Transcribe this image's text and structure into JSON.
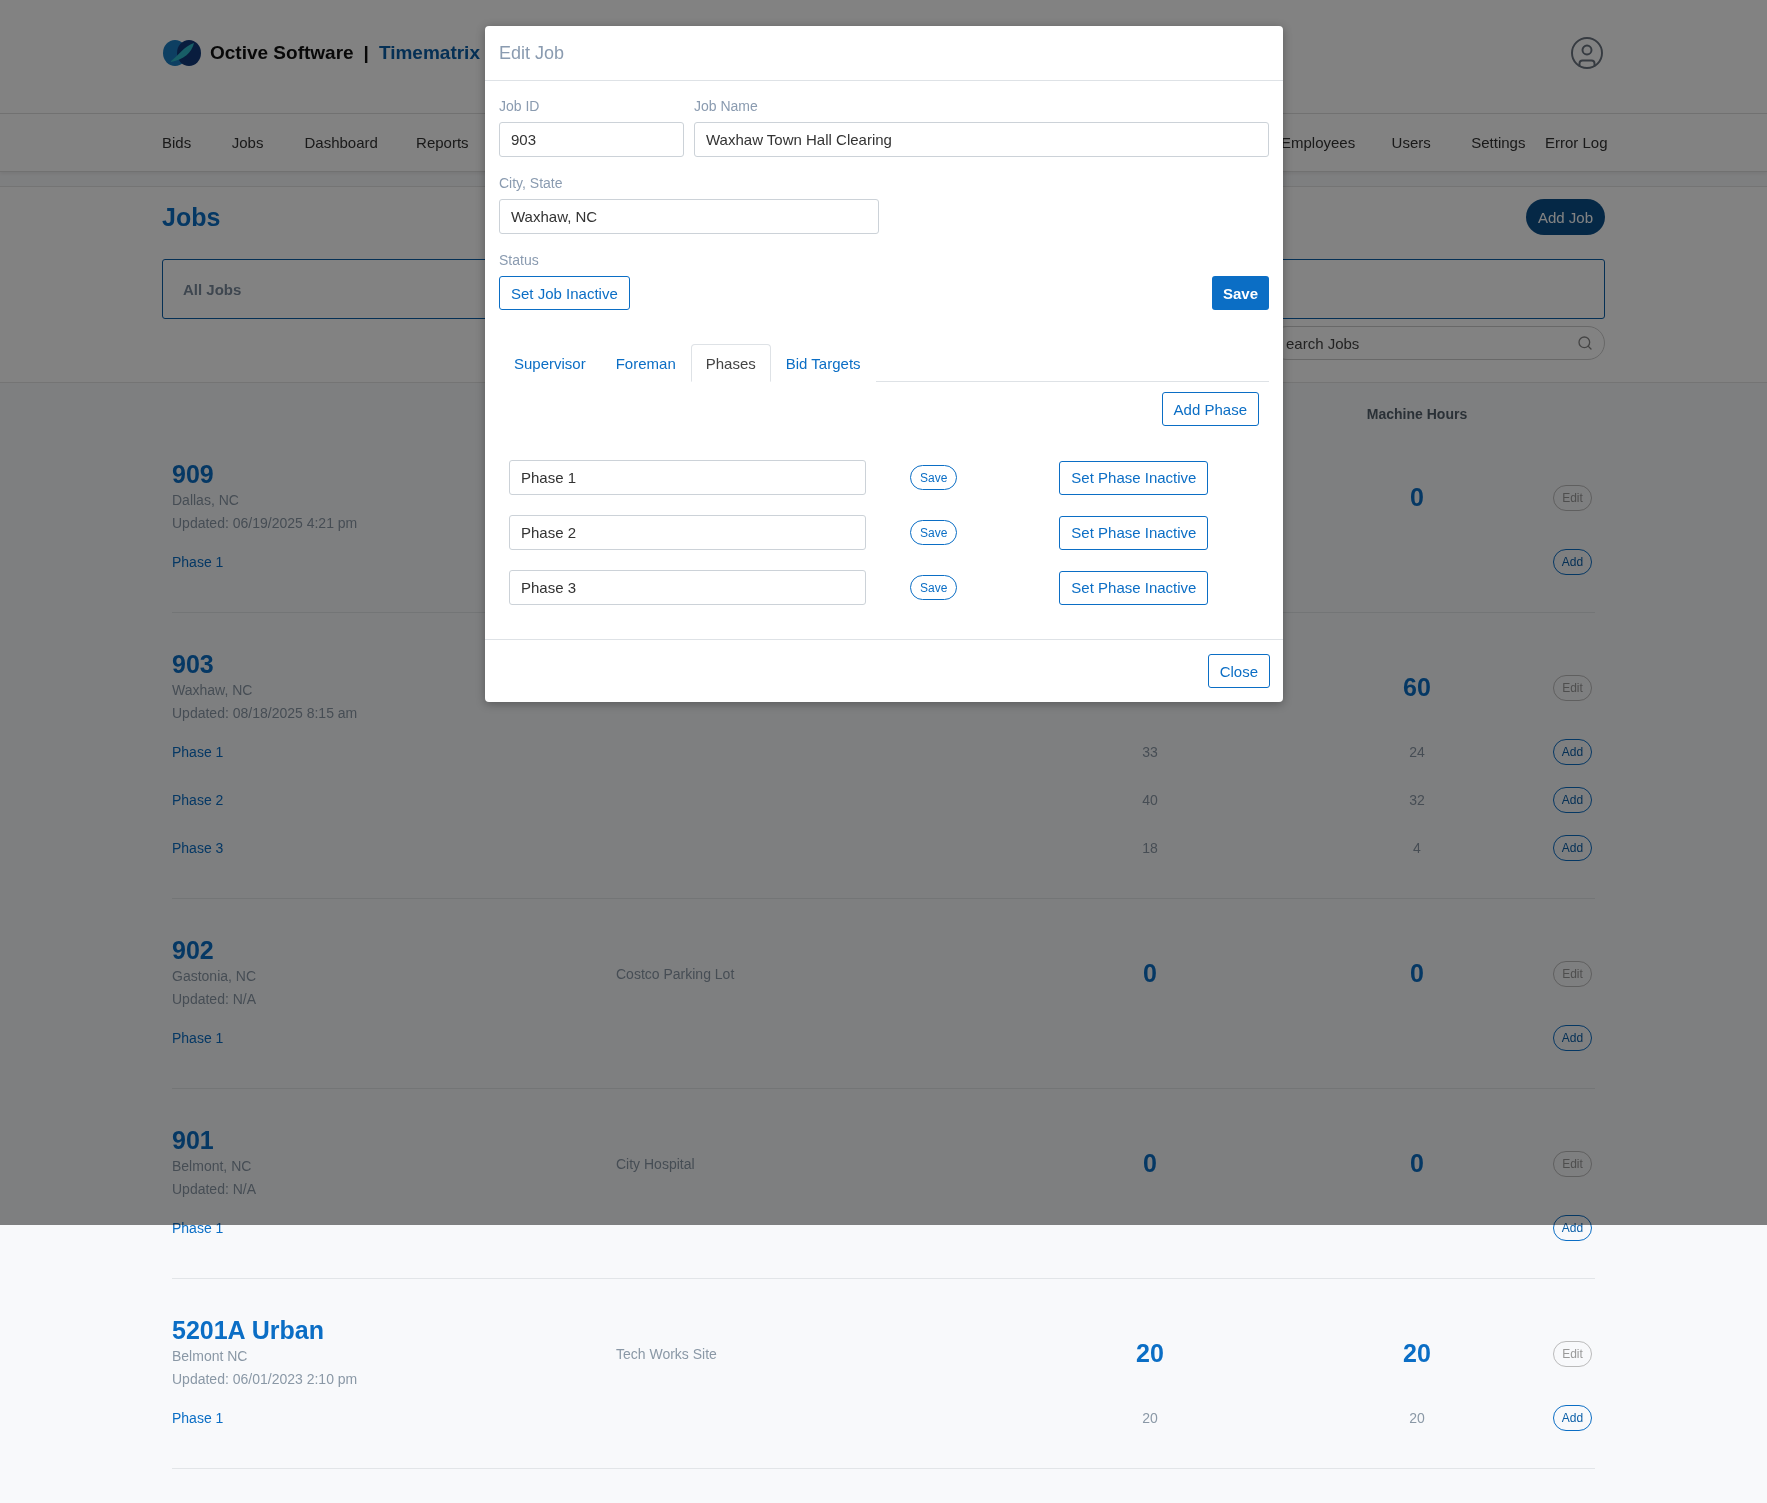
{
  "brand": {
    "company": "Octive Software",
    "separator": "|",
    "product": "Timematrix"
  },
  "nav": [
    "Bids",
    "Jobs",
    "Dashboard",
    "Reports",
    "Employees",
    "Users",
    "Settings",
    "Error Log"
  ],
  "page_title": "Jobs",
  "add_job": "Add Job",
  "filter": {
    "label": "All Jobs"
  },
  "search": {
    "placeholder": "earch Jobs"
  },
  "columns": {
    "machine_hours": "Machine Hours"
  },
  "jobs": [
    {
      "id": "909",
      "location": "Dallas, NC",
      "updated": "Updated: 06/19/2025 4:21 pm",
      "machine_hours": "0",
      "edit": "Edit",
      "phases": [
        {
          "name": "Phase 1",
          "add": "Add"
        }
      ]
    },
    {
      "id": "903",
      "location": "Waxhaw, NC",
      "updated": "Updated: 08/18/2025 8:15 am",
      "machine_hours": "60",
      "edit": "Edit",
      "phases": [
        {
          "name": "Phase 1",
          "hours": "33",
          "machine_hours": "24",
          "add": "Add"
        },
        {
          "name": "Phase 2",
          "hours": "40",
          "machine_hours": "32",
          "add": "Add"
        },
        {
          "name": "Phase 3",
          "hours": "18",
          "machine_hours": "4",
          "add": "Add"
        }
      ]
    },
    {
      "id": "902",
      "location": "Gastonia, NC",
      "updated": "Updated: N/A",
      "name": "Costco Parking Lot",
      "hours": "0",
      "machine_hours": "0",
      "edit": "Edit",
      "phases": [
        {
          "name": "Phase 1",
          "add": "Add"
        }
      ]
    },
    {
      "id": "901",
      "location": "Belmont, NC",
      "updated": "Updated: N/A",
      "name": "City Hospital",
      "hours": "0",
      "machine_hours": "0",
      "edit": "Edit",
      "phases": [
        {
          "name": "Phase 1",
          "add": "Add"
        }
      ]
    },
    {
      "id": "5201A Urban",
      "location": "Belmont NC",
      "updated": "Updated: 06/01/2023 2:10 pm",
      "name": "Tech Works Site",
      "hours": "20",
      "machine_hours": "20",
      "edit": "Edit",
      "phases": [
        {
          "name": "Phase 1",
          "hours": "20",
          "machine_hours": "20",
          "add": "Add"
        }
      ]
    }
  ],
  "modal": {
    "title": "Edit Job",
    "job_id": {
      "label": "Job ID",
      "value": "903"
    },
    "job_name": {
      "label": "Job Name",
      "value": "Waxhaw Town Hall Clearing"
    },
    "city_state": {
      "label": "City, State",
      "value": "Waxhaw, NC"
    },
    "status": {
      "label": "Status",
      "button": "Set Job Inactive"
    },
    "save": "Save",
    "tabs": [
      {
        "label": "Supervisor",
        "selected": false
      },
      {
        "label": "Foreman",
        "selected": false
      },
      {
        "label": "Phases",
        "selected": true
      },
      {
        "label": "Bid Targets",
        "selected": false
      }
    ],
    "add_phase": "Add Phase",
    "phases": [
      {
        "value": "Phase 1",
        "save": "Save",
        "inactive": "Set Phase Inactive"
      },
      {
        "value": "Phase 2",
        "save": "Save",
        "inactive": "Set Phase Inactive"
      },
      {
        "value": "Phase 3",
        "save": "Save",
        "inactive": "Set Phase Inactive"
      }
    ],
    "close": "Close"
  }
}
